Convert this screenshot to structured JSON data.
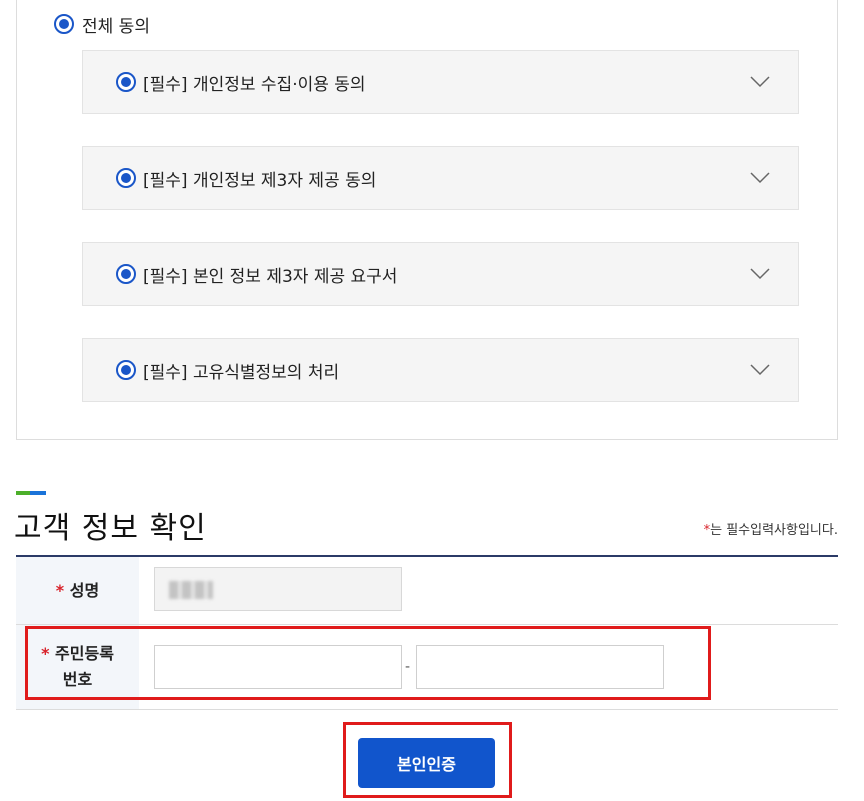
{
  "consent": {
    "all_label": "전체 동의",
    "items": [
      {
        "label": "[필수] 개인정보 수집·이용 동의",
        "checked": true
      },
      {
        "label": "[필수] 개인정보 제3자 제공 동의",
        "checked": true
      },
      {
        "label": "[필수] 본인 정보 제3자 제공 요구서",
        "checked": true
      },
      {
        "label": "[필수] 고유식별정보의 처리",
        "checked": true
      }
    ]
  },
  "customer_info": {
    "title": "고객 정보 확인",
    "required_star": "*",
    "required_note": "는 필수입력사항입니다.",
    "name_label": "성명",
    "rrn_label_line1": "주민등록",
    "rrn_label_line2": "번호",
    "rrn_separator": "-",
    "rrn_first_value": "",
    "rrn_second_value": ""
  },
  "verify_button_label": "본인인증",
  "colors": {
    "accent_blue": "#1155cc",
    "radio_blue": "#1a56c8",
    "required_red": "#d8222a",
    "highlight_red": "#e01b1b",
    "bar_green": "#4caf2a",
    "bar_blue": "#1a73d9"
  }
}
